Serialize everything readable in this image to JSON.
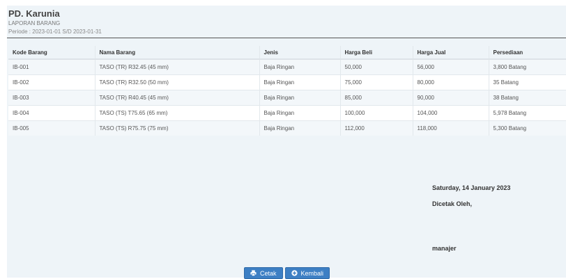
{
  "header": {
    "company": "PD. Karunia",
    "report_name": "LAPORAN BARANG",
    "period": "Periode : 2023-01-01 S/D 2023-01-31"
  },
  "table": {
    "columns": [
      "Kode Barang",
      "Nama Barang",
      "Jenis",
      "Harga Beli",
      "Harga Jual",
      "Persediaan"
    ],
    "rows": [
      [
        "IB-001",
        "TASO (TR) R32.45 (45 mm)",
        "Baja Ringan",
        "50,000",
        "56,000",
        "3,800 Batang"
      ],
      [
        "IB-002",
        "TASO (TR) R32.50 (50 mm)",
        "Baja Ringan",
        "75,000",
        "80,000",
        "35 Batang"
      ],
      [
        "IB-003",
        "TASO (TR) R40.45 (45 mm)",
        "Baja Ringan",
        "85,000",
        "90,000",
        "38 Batang"
      ],
      [
        "IB-004",
        "TASO (TS) T75.65 (65 mm)",
        "Baja Ringan",
        "100,000",
        "104,000",
        "5,978 Batang"
      ],
      [
        "IB-005",
        "TASO (TS) R75.75 (75 mm)",
        "Baja Ringan",
        "112,000",
        "118,000",
        "5,300 Batang"
      ]
    ]
  },
  "signature": {
    "date": "Saturday, 14 January 2023",
    "label": "Dicetak Oleh,",
    "name": "manajer"
  },
  "actions": {
    "print_label": "Cetak",
    "back_label": "Kembali",
    "print_icon": "printer-icon",
    "back_icon": "plus-circle-icon",
    "button_color": "#3d7fc4"
  }
}
